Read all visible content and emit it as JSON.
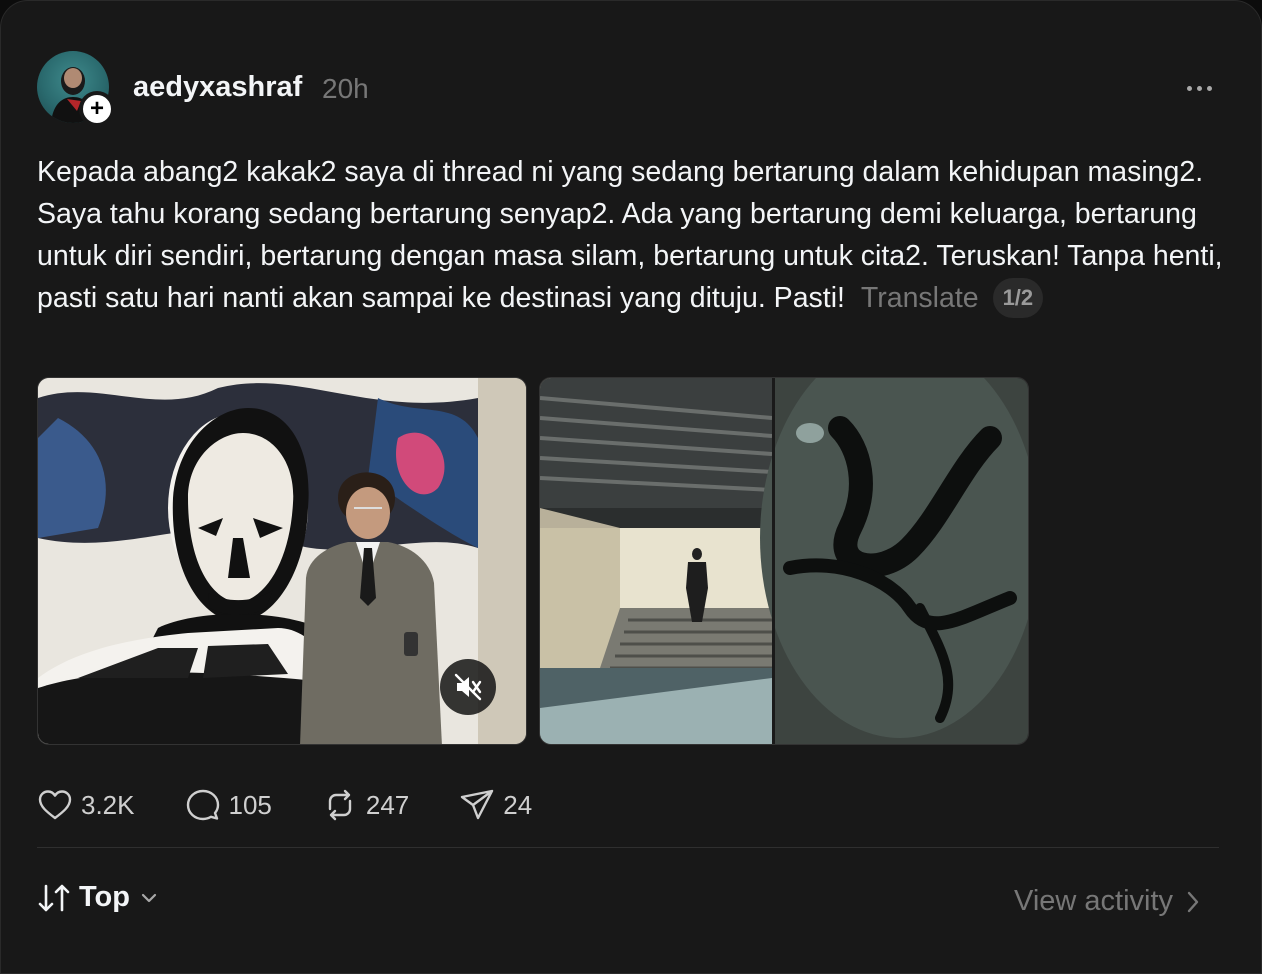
{
  "post": {
    "username": "aedyxashraf",
    "timestamp": "20h",
    "text": "Kepada abang2 kakak2 saya di thread ni yang sedang bertarung dalam kehidupan masing2. Saya tahu korang sedang bertarung senyap2. Ada yang bertarung demi keluarga, bertarung untuk diri sendiri, bertarung dengan masa silam, bertarung untuk cita2. Teruskan! Tanpa henti, pasti satu hari nanti akan sampai ke destinasi yang dituju. Pasti!",
    "translate_label": "Translate",
    "page_indicator": "1/2"
  },
  "media": [
    {
      "kind": "video",
      "muted": true
    },
    {
      "kind": "image"
    }
  ],
  "actions": {
    "likes": "3.2K",
    "replies": "105",
    "reposts": "247",
    "shares": "24"
  },
  "footer": {
    "sort_label": "Top",
    "view_activity_label": "View activity"
  },
  "icons": [
    "plus-icon",
    "more-icon",
    "mute-icon",
    "heart-icon",
    "comment-icon",
    "repost-icon",
    "share-icon",
    "sort-icon",
    "chevron-down-icon",
    "chevron-right-icon"
  ],
  "colors": {
    "background": "#181818",
    "text": "#f3f5f7",
    "muted": "#777777"
  }
}
